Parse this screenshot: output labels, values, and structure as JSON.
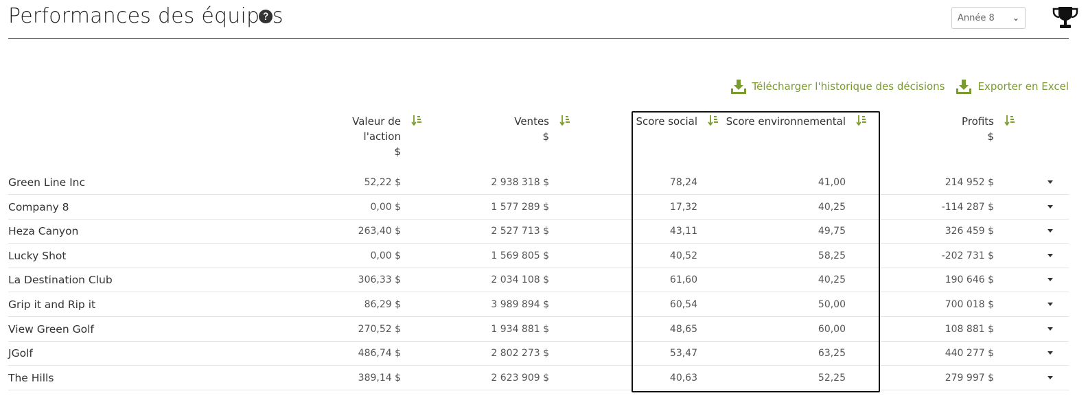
{
  "page": {
    "title": "Performances des équipes",
    "year_select": {
      "value": "Année 8"
    }
  },
  "actions": {
    "download_history": "Télécharger l'historique des décisions",
    "export_excel": "Exporter en Excel"
  },
  "colors": {
    "accent": "#7a9b2e",
    "text": "#333333",
    "divider": "#e2e2e2"
  },
  "columns": {
    "share": {
      "line1": "Valeur de",
      "line2": "l'action",
      "unit": "$"
    },
    "sales": {
      "line1": "Ventes",
      "unit": "$"
    },
    "social": {
      "label": "Score social"
    },
    "env": {
      "label": "Score environnemental"
    },
    "profits": {
      "line1": "Profits",
      "unit": "$"
    }
  },
  "rows": [
    {
      "name": "Green Line Inc",
      "share": "52,22 $",
      "sales": "2 938 318 $",
      "social": "78,24",
      "env": "41,00",
      "profits": "214 952 $"
    },
    {
      "name": "Company 8",
      "share": "0,00 $",
      "sales": "1 577 289 $",
      "social": "17,32",
      "env": "40,25",
      "profits": "-114 287 $"
    },
    {
      "name": "Heza Canyon",
      "share": "263,40 $",
      "sales": "2 527 713 $",
      "social": "43,11",
      "env": "49,75",
      "profits": "326 459 $"
    },
    {
      "name": "Lucky Shot",
      "share": "0,00 $",
      "sales": "1 569 805 $",
      "social": "40,52",
      "env": "58,25",
      "profits": "-202 731 $"
    },
    {
      "name": "La Destination Club",
      "share": "306,33 $",
      "sales": "2 034 108 $",
      "social": "61,60",
      "env": "40,25",
      "profits": "190 646 $"
    },
    {
      "name": "Grip it and Rip it",
      "share": "86,29 $",
      "sales": "3 989 894 $",
      "social": "60,54",
      "env": "50,00",
      "profits": "700 018 $"
    },
    {
      "name": "View Green Golf",
      "share": "270,52 $",
      "sales": "1 934 881 $",
      "social": "48,65",
      "env": "60,00",
      "profits": "108 881 $"
    },
    {
      "name": "JGolf",
      "share": "486,74 $",
      "sales": "2 802 273 $",
      "social": "53,47",
      "env": "63,25",
      "profits": "440 277 $"
    },
    {
      "name": "The Hills",
      "share": "389,14 $",
      "sales": "2 623 909 $",
      "social": "40,63",
      "env": "52,25",
      "profits": "279 997 $"
    }
  ]
}
